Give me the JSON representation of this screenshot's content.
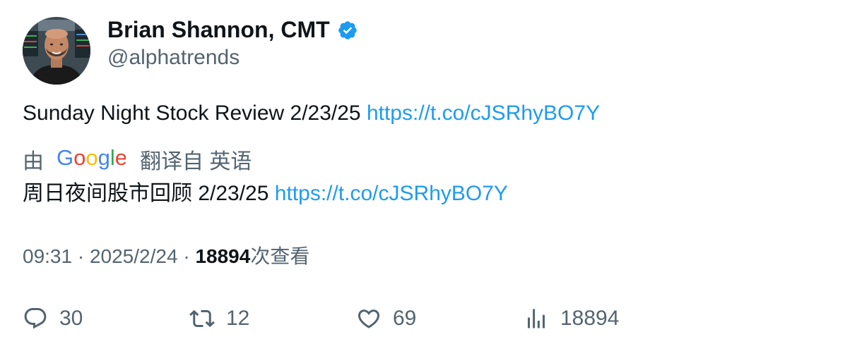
{
  "author": {
    "display_name": "Brian Shannon, CMT",
    "handle": "@alphatrends",
    "verified": true
  },
  "tweet": {
    "text": "Sunday Night Stock Review 2/23/25",
    "link": "https://t.co/cJSRhyBO7Y"
  },
  "translation": {
    "by_label": "由",
    "provider": "Google",
    "from_label": "翻译自 英语",
    "text": "周日夜间股市回顾 2/23/25",
    "link": "https://t.co/cJSRhyBO7Y"
  },
  "meta": {
    "time": "09:31",
    "separator": "·",
    "date": "2025/2/24",
    "views_count": "18894",
    "views_label": "次查看"
  },
  "actions": {
    "replies": "30",
    "retweets": "12",
    "likes": "69",
    "views": "18894"
  },
  "colors": {
    "link": "#1d9bf0",
    "secondary_text": "#536471",
    "verified": "#1d9bf0"
  }
}
